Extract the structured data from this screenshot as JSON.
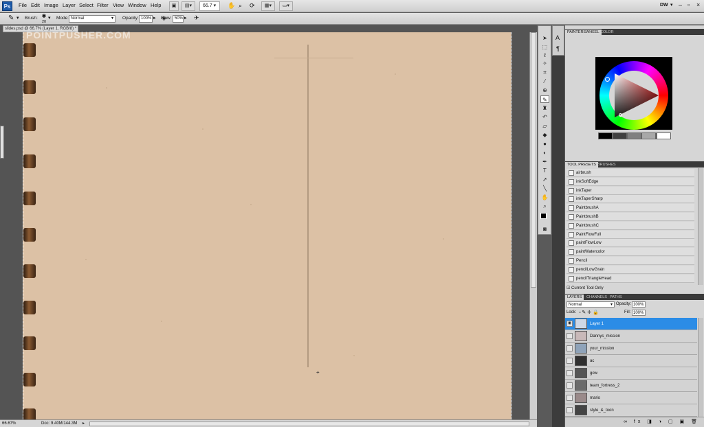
{
  "app": {
    "logo": "Ps",
    "menus": [
      "File",
      "Edit",
      "Image",
      "Layer",
      "Select",
      "Filter",
      "View",
      "Window",
      "Help"
    ],
    "zoom_field": "66.7",
    "workspace": "DW"
  },
  "options": {
    "brush_label": "Brush:",
    "brush_size": "20",
    "mode_label": "Mode:",
    "mode_value": "Normal",
    "opacity_label": "Opacity:",
    "opacity_value": "100%",
    "flow_label": "Flow:",
    "flow_value": "50%"
  },
  "document": {
    "tab_title": "slides.psd @ 66.7% (Layer 1, RGB/8) *",
    "watermark": "POINTPUSHER.COM",
    "status_zoom": "66.67%",
    "status_doc": "Doc: 9.40M/144.3M"
  },
  "color_panel": {
    "tabs": [
      "PAINTERSWHEEL",
      "COLOR"
    ],
    "swatches": [
      "#000000",
      "#404040",
      "#808080",
      "#a8a8a8",
      "#d0d0d0",
      "#ffffff"
    ]
  },
  "tool_presets": {
    "tabs": [
      "TOOL PRESETS",
      "BRUSHES"
    ],
    "items": [
      "airbrush",
      "inkSoftEdge",
      "inkTaper",
      "inkTaperSharp",
      "PaintbrushA",
      "PaintbrushB",
      "PaintbrushC",
      "PaintFlowFull",
      "paintFlowLow",
      "paintWatercolor",
      "Pencil",
      "pencilLowGrain",
      "pencilTriangleHead"
    ],
    "current_tool_only": "Current Tool Only"
  },
  "layers_panel": {
    "tabs": [
      "LAYERS",
      "CHANNELS",
      "PATHS"
    ],
    "blend_mode": "Normal",
    "opacity_label": "Opacity:",
    "opacity_value": "100%",
    "lock_label": "Lock:",
    "fill_label": "Fill:",
    "fill_value": "100%",
    "layers": [
      {
        "name": "Layer 1",
        "selected": true,
        "visible": true
      },
      {
        "name": "Dannys_mission",
        "selected": false,
        "visible": false
      },
      {
        "name": "your_mission",
        "selected": false,
        "visible": false
      },
      {
        "name": "ac",
        "selected": false,
        "visible": false
      },
      {
        "name": "gow",
        "selected": false,
        "visible": false
      },
      {
        "name": "team_fortress_2",
        "selected": false,
        "visible": false
      },
      {
        "name": "mario",
        "selected": false,
        "visible": false
      },
      {
        "name": "style_&_toon",
        "selected": false,
        "visible": false
      }
    ]
  }
}
